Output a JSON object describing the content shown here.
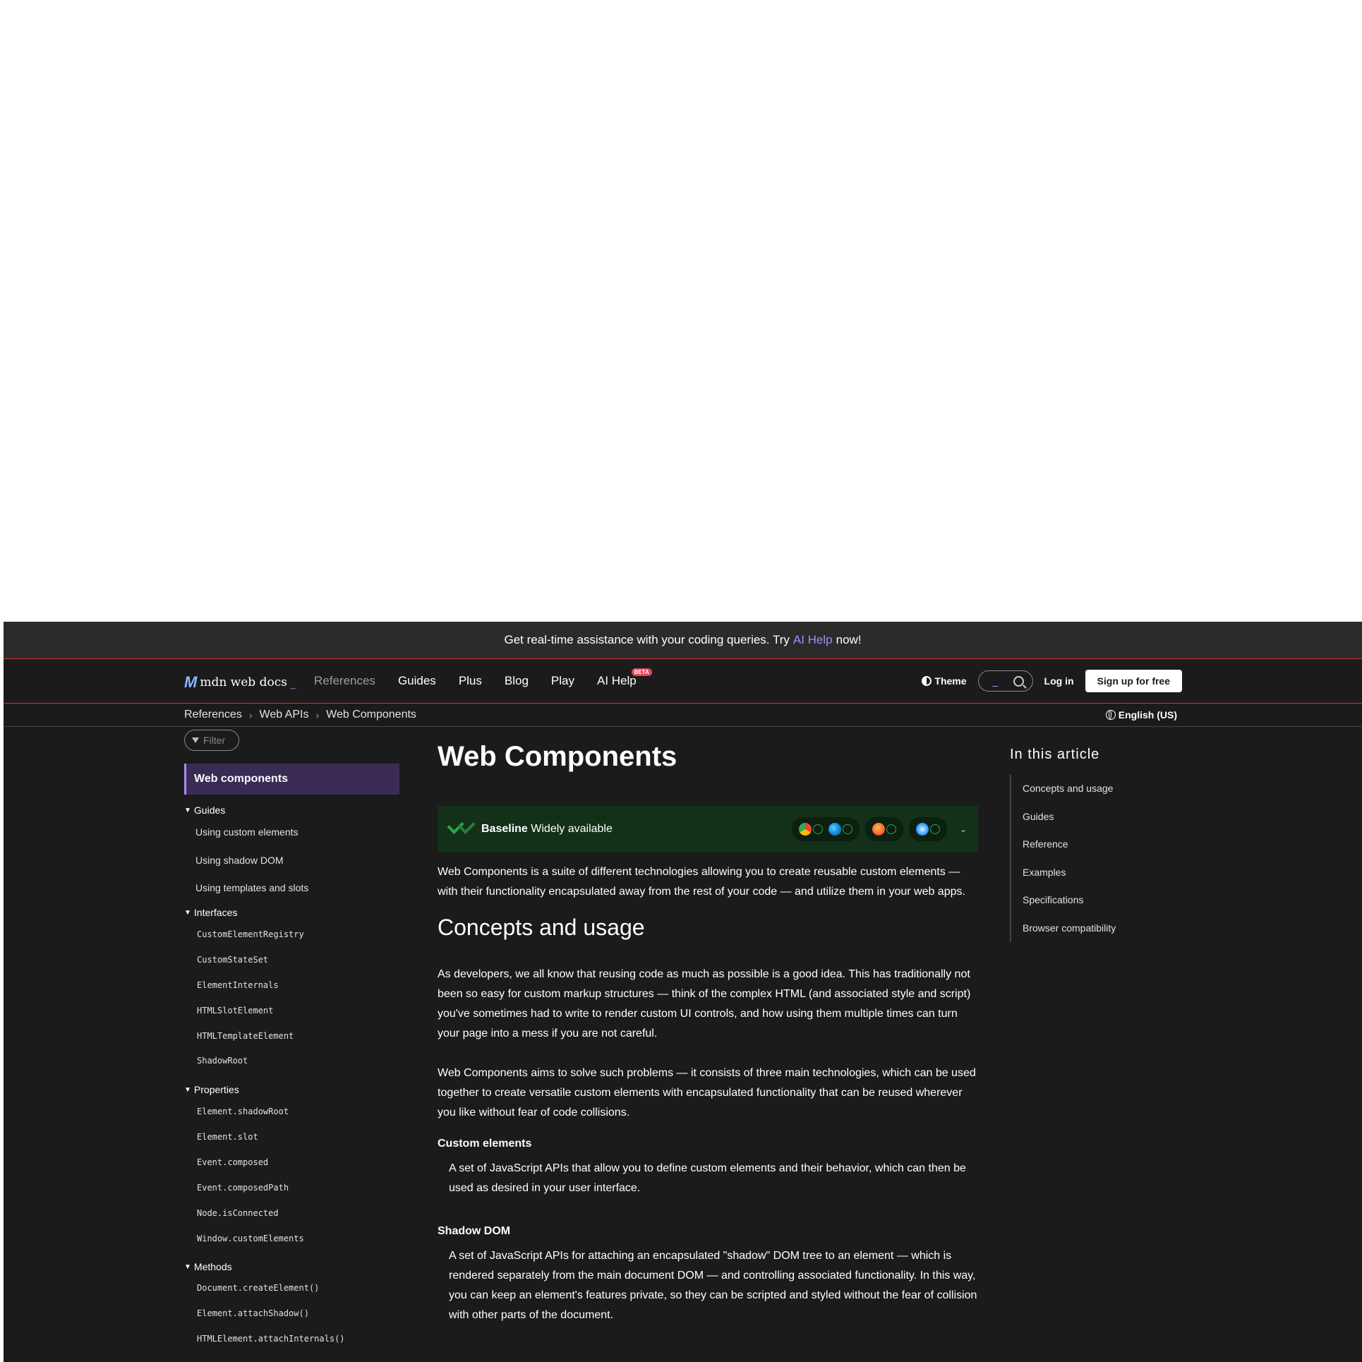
{
  "banner": {
    "text_before": "Get real-time assistance with your coding queries. Try",
    "link": "AI Help",
    "text_after": "now!"
  },
  "nav": {
    "logo_text": "mdn web docs",
    "items": [
      "References",
      "Guides",
      "Plus",
      "Blog",
      "Play",
      "AI Help"
    ],
    "beta_badge": "BETA",
    "theme": "Theme",
    "login": "Log in",
    "signup": "Sign up for free"
  },
  "breadcrumb": [
    "References",
    "Web APIs",
    "Web Components"
  ],
  "language": "English (US)",
  "sidebar": {
    "filter_placeholder": "Filter",
    "heading": "Web components",
    "guides_label": "Guides",
    "guides": [
      "Using custom elements",
      "Using shadow DOM",
      "Using templates and slots"
    ],
    "interfaces_label": "Interfaces",
    "interfaces": [
      "CustomElementRegistry",
      "CustomStateSet",
      "ElementInternals",
      "HTMLSlotElement",
      "HTMLTemplateElement",
      "ShadowRoot"
    ],
    "properties_label": "Properties",
    "properties": [
      "Element.shadowRoot",
      "Element.slot",
      "Event.composed",
      "Event.composedPath",
      "Node.isConnected",
      "Window.customElements"
    ],
    "methods_label": "Methods",
    "methods": [
      "Document.createElement()",
      "Element.attachShadow()",
      "HTMLElement.attachInternals()"
    ]
  },
  "main": {
    "title": "Web Components",
    "baseline_bold": "Baseline",
    "baseline_text": "Widely available",
    "intro": "Web Components is a suite of different technologies allowing you to create reusable custom elements — with their functionality encapsulated away from the rest of your code — and utilize them in your web apps.",
    "h2_concepts": "Concepts and usage",
    "p1": "As developers, we all know that reusing code as much as possible is a good idea. This has traditionally not been so easy for custom markup structures — think of the complex HTML (and associated style and script) you've sometimes had to write to render custom UI controls, and how using them multiple times can turn your page into a mess if you are not careful.",
    "p2": "Web Components aims to solve such problems — it consists of three main technologies, which can be used together to create versatile custom elements with encapsulated functionality that can be reused wherever you like without fear of code collisions.",
    "h3_custom": "Custom elements",
    "dd_custom": "A set of JavaScript APIs that allow you to define custom elements and their behavior, which can then be used as desired in your user interface.",
    "h3_shadow": "Shadow DOM",
    "dd_shadow": "A set of JavaScript APIs for attaching an encapsulated \"shadow\" DOM tree to an element — which is rendered separately from the main document DOM — and controlling associated functionality. In this way, you can keep an element's features private, so they can be scripted and styled without the fear of collision with other parts of the document."
  },
  "toc": {
    "title": "In this article",
    "items": [
      "Concepts and usage",
      "Guides",
      "Reference",
      "Examples",
      "Specifications",
      "Browser compatibility"
    ]
  }
}
